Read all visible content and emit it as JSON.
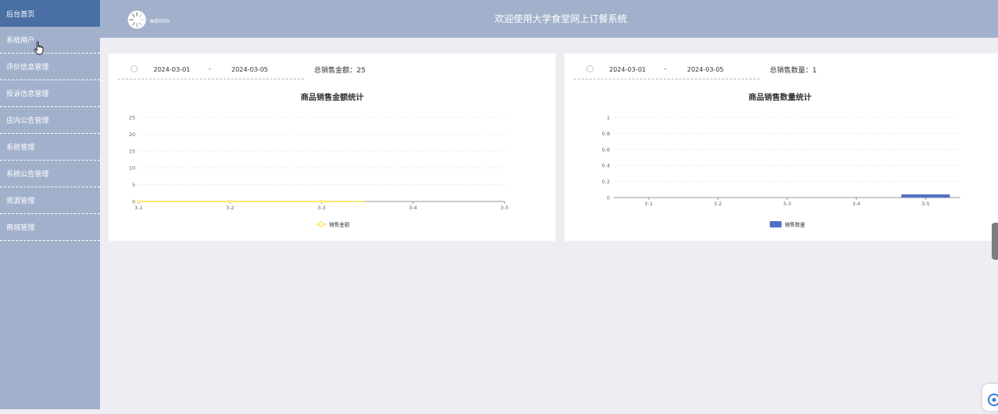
{
  "sidebar": {
    "items": [
      {
        "label": "后台首页",
        "active": true
      },
      {
        "label": "系统用户",
        "active": false
      },
      {
        "label": "评价信息管理",
        "active": false
      },
      {
        "label": "投诉信息管理",
        "active": false
      },
      {
        "label": "店内公告管理",
        "active": false
      },
      {
        "label": "系统管理",
        "active": false
      },
      {
        "label": "系统公告管理",
        "active": false
      },
      {
        "label": "资源管理",
        "active": false
      },
      {
        "label": "商城管理",
        "active": false
      }
    ]
  },
  "header": {
    "username": "admin",
    "title": "欢迎使用大学食堂网上订餐系统",
    "avatar_icon": "loading-spinner-icon"
  },
  "cards": [
    {
      "start_date": "2024-03-01",
      "separator": "-",
      "end_date": "2024-03-05",
      "total_label": "总销售金额：25",
      "chart_title": "商品销售金额统计"
    },
    {
      "start_date": "2024-03-01",
      "separator": "-",
      "end_date": "2024-03-05",
      "total_label": "总销售数量：1",
      "chart_title": "商品销售数量统计"
    }
  ],
  "chart_data": [
    {
      "type": "line",
      "title": "商品销售金额统计",
      "categories": [
        "3-1",
        "3-2",
        "3-3",
        "3-4",
        "3-5"
      ],
      "ylim": [
        0,
        25
      ],
      "yticks": [
        0,
        5,
        10,
        15,
        20,
        25
      ],
      "series": [
        {
          "name": "销售金额",
          "values": [
            0,
            0,
            0,
            null,
            null
          ],
          "color": "#fce14a"
        }
      ],
      "grid": true,
      "legend": "bottom-center"
    },
    {
      "type": "bar",
      "title": "商品销售数量统计",
      "categories": [
        "3-1",
        "3-2",
        "3-3",
        "3-4",
        "3-5"
      ],
      "ylim": [
        0,
        1
      ],
      "yticks": [
        "0",
        "0.2",
        "0.4",
        "0.6",
        "0.8",
        "1"
      ],
      "series": [
        {
          "name": "销售数量",
          "values": [
            0,
            0,
            0,
            0,
            0.04
          ],
          "color": "#5470c6"
        }
      ],
      "grid": true,
      "legend": "bottom-center"
    }
  ]
}
